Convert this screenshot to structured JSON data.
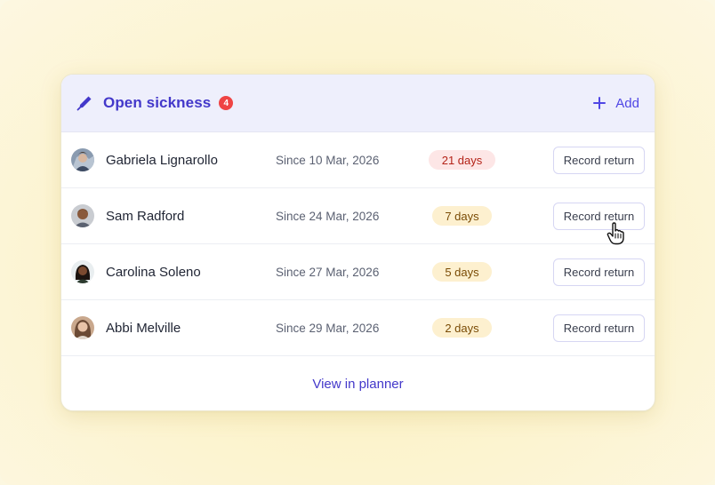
{
  "card": {
    "title": "Open sickness",
    "count": "4",
    "add_label": "Add",
    "header_icon": "pen-icon",
    "footer_link": "View in planner"
  },
  "rows": [
    {
      "name": "Gabriela Lignarollo",
      "since": "Since 10 Mar, 2026",
      "duration": "21 days",
      "status": "red",
      "action": "Record return"
    },
    {
      "name": "Sam Radford",
      "since": "Since 24 Mar, 2026",
      "duration": "7 days",
      "status": "amber",
      "action": "Record return"
    },
    {
      "name": "Carolina Soleno",
      "since": "Since 27 Mar, 2026",
      "duration": "5 days",
      "status": "amber",
      "action": "Record return"
    },
    {
      "name": "Abbi Melville",
      "since": "Since 29 Mar, 2026",
      "duration": "2 days",
      "status": "amber",
      "action": "Record return"
    }
  ],
  "colors": {
    "accent": "#4338ca",
    "header_bg": "#eeeffc",
    "badge_red": "#ef4444",
    "pill_red_bg": "#fde6e6",
    "pill_amber_bg": "#fdf0cf"
  }
}
